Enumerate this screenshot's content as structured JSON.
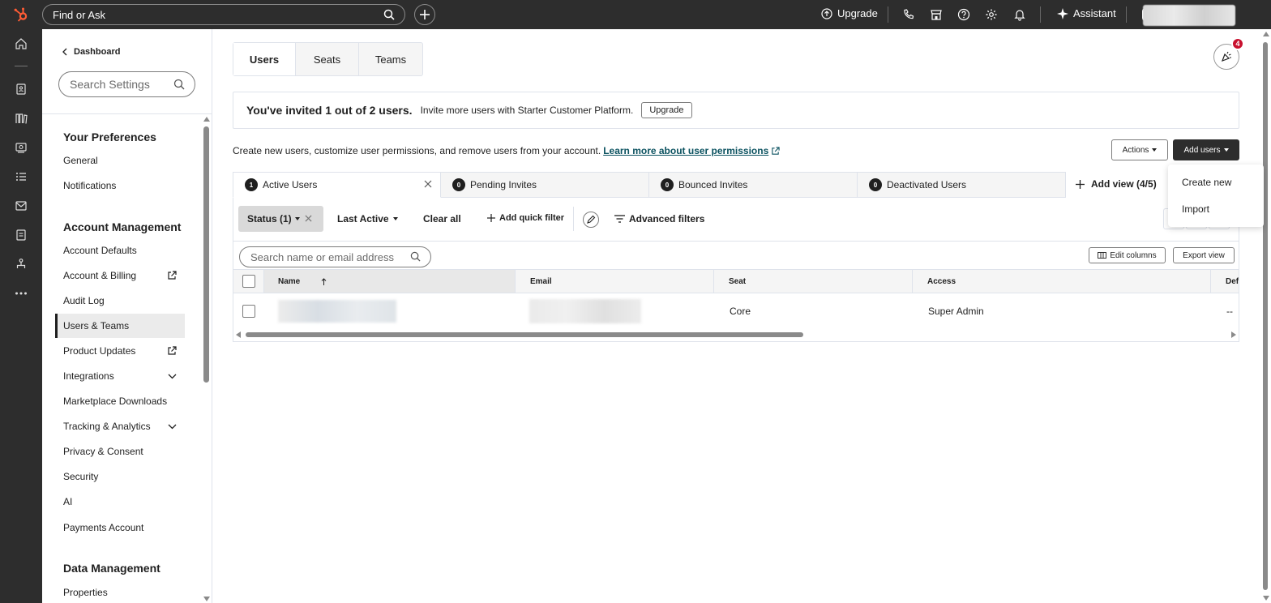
{
  "topbar": {
    "search_label": "Find or Ask",
    "upgrade_label": "Upgrade",
    "assistant_label": "Assistant"
  },
  "sidebar": {
    "back_label": "Dashboard",
    "search_placeholder": "Search Settings",
    "sections": [
      {
        "title": "Your Preferences"
      },
      {
        "title": "Account Management"
      },
      {
        "title": "Data Management"
      }
    ],
    "items": [
      {
        "label": "General"
      },
      {
        "label": "Notifications"
      },
      {
        "label": "Account Defaults"
      },
      {
        "label": "Account & Billing",
        "icon": "external-link-icon"
      },
      {
        "label": "Audit Log"
      },
      {
        "label": "Users & Teams",
        "active": true
      },
      {
        "label": "Product Updates",
        "icon": "external-link-icon"
      },
      {
        "label": "Integrations",
        "icon": "chevron-down-icon"
      },
      {
        "label": "Marketplace Downloads"
      },
      {
        "label": "Tracking & Analytics",
        "icon": "chevron-down-icon"
      },
      {
        "label": "Privacy & Consent"
      },
      {
        "label": "Security"
      },
      {
        "label": "AI"
      },
      {
        "label": "Payments Account"
      },
      {
        "label": "Properties"
      }
    ]
  },
  "main": {
    "tabs": [
      {
        "label": "Users",
        "active": true
      },
      {
        "label": "Seats"
      },
      {
        "label": "Teams"
      }
    ],
    "notification_count": "4",
    "banner": {
      "headline": "You've invited 1 out of 2 users.",
      "text": "Invite more users with Starter Customer Platform.",
      "button": "Upgrade"
    },
    "description": "Create new users, customize user permissions, and remove users from your account.",
    "learn_more": "Learn more about user permissions",
    "actions_label": "Actions",
    "add_users_label": "Add users",
    "add_users_menu": [
      "Create new",
      "Import"
    ],
    "view_tabs": [
      {
        "count": "1",
        "label": "Active Users"
      },
      {
        "count": "0",
        "label": "Pending Invites"
      },
      {
        "count": "0",
        "label": "Bounced Invites"
      },
      {
        "count": "0",
        "label": "Deactivated Users"
      }
    ],
    "add_view_label": "Add view (4/5)",
    "filters": {
      "status": "Status (1)",
      "last_active": "Last Active",
      "clear_all": "Clear all",
      "add_quick_filter": "Add quick filter",
      "advanced_filters": "Advanced filters"
    },
    "table": {
      "search_placeholder": "Search name or email address",
      "edit_columns": "Edit columns",
      "export_view": "Export view",
      "columns": [
        "Name",
        "Email",
        "Seat",
        "Access",
        "Def"
      ],
      "rows": [
        {
          "name": "",
          "email": "",
          "seat": "Core",
          "access": "Super Admin",
          "default": "--"
        }
      ]
    }
  },
  "colors": {
    "topbar_bg": "#2d2d2d",
    "link": "#0b5260",
    "badge": "#c8102e"
  }
}
